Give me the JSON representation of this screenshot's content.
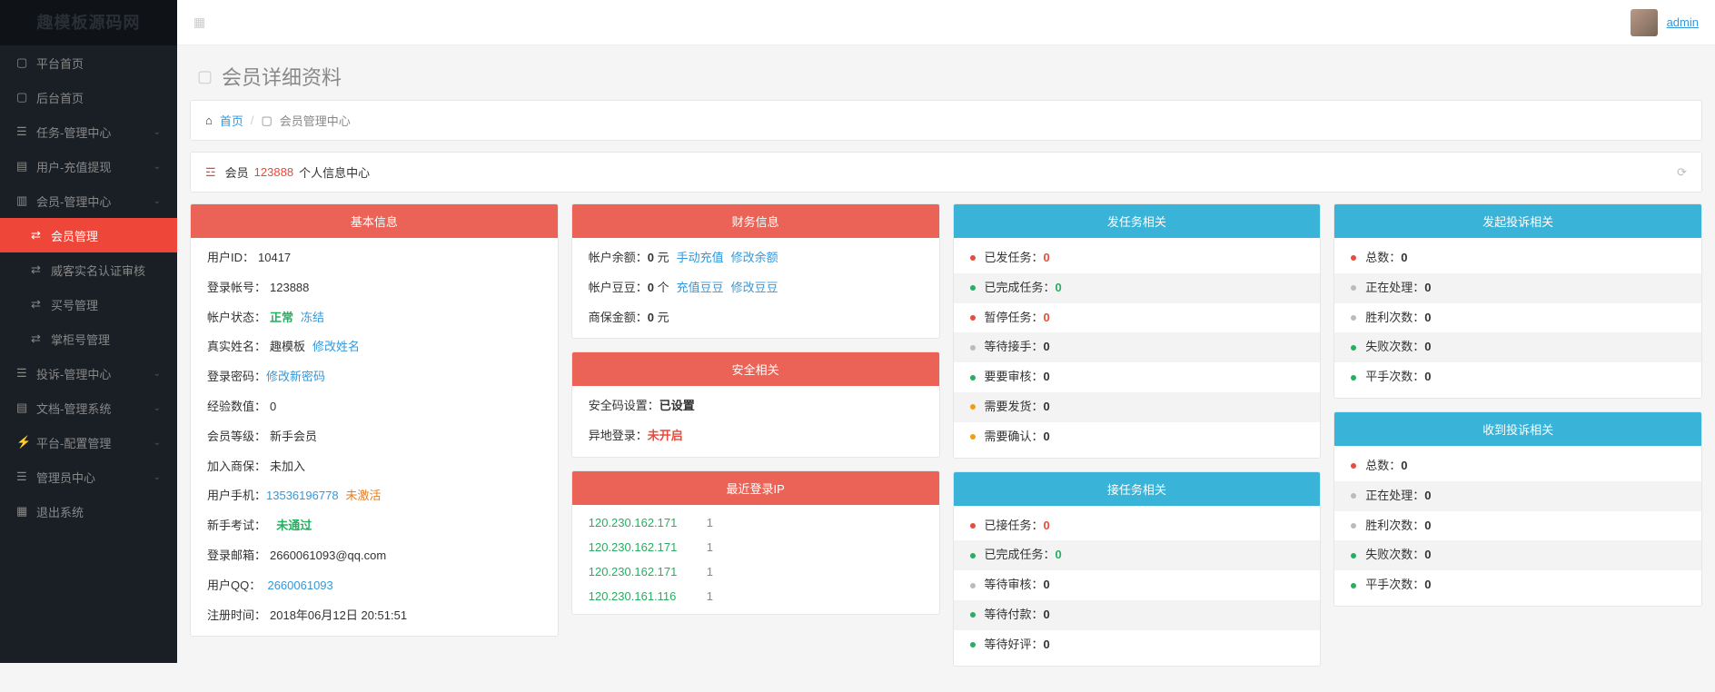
{
  "logo": "趣模板源码网",
  "user": {
    "name": "admin"
  },
  "nav": [
    {
      "icon": "▢",
      "label": "平台首页"
    },
    {
      "icon": "▢",
      "label": "后台首页"
    },
    {
      "icon": "☰",
      "label": "任务-管理中心",
      "chev": true
    },
    {
      "icon": "▤",
      "label": "用户-充值提现",
      "chev": true
    },
    {
      "icon": "▥",
      "label": "会员-管理中心",
      "chev": true
    },
    {
      "icon": "⇄",
      "label": "会员管理",
      "active": true,
      "sub": true
    },
    {
      "icon": "⇄",
      "label": "威客实名认证审核",
      "sub": true
    },
    {
      "icon": "⇄",
      "label": "买号管理",
      "sub": true
    },
    {
      "icon": "⇄",
      "label": "掌柜号管理",
      "sub": true
    },
    {
      "icon": "☰",
      "label": "投诉-管理中心",
      "chev": true
    },
    {
      "icon": "▤",
      "label": "文档-管理系统",
      "chev": true
    },
    {
      "icon": "⚡",
      "label": "平台-配置管理",
      "chev": true
    },
    {
      "icon": "☰",
      "label": "管理员中心",
      "chev": true
    },
    {
      "icon": "▦",
      "label": "退出系统"
    }
  ],
  "pageTitle": "会员详细资料",
  "breadcrumb": {
    "home": "首页",
    "current": "会员管理中心"
  },
  "panel": {
    "prefix": "会员",
    "id": "123888",
    "suffix": "个人信息中心"
  },
  "basic": {
    "title": "基本信息",
    "userId": {
      "l": "用户ID：",
      "v": "10417"
    },
    "account": {
      "l": "登录帐号：",
      "v": "123888"
    },
    "status": {
      "l": "帐户状态：",
      "v": "正常",
      "action": "冻结"
    },
    "realname": {
      "l": "真实姓名：",
      "v": "趣模板",
      "action": "修改姓名"
    },
    "pwd": {
      "l": "登录密码：",
      "action": "修改新密码"
    },
    "exp": {
      "l": "经验数值：",
      "v": "0"
    },
    "level": {
      "l": "会员等级：",
      "v": "新手会员"
    },
    "merch": {
      "l": "加入商保：",
      "v": "未加入"
    },
    "phone": {
      "l": "用户手机：",
      "v": "13536196778",
      "status": "未激活"
    },
    "exam": {
      "l": "新手考试：",
      "v": "未通过"
    },
    "email": {
      "l": "登录邮箱：",
      "v": "2660061093@qq.com"
    },
    "qq": {
      "l": "用户QQ：",
      "v": "2660061093"
    },
    "reg": {
      "l": "注册时间：",
      "v": "2018年06月12日 20:51:51"
    }
  },
  "finance": {
    "title": "财务信息",
    "balance": {
      "l": "帐户余额：",
      "v": "0",
      "u": "元",
      "a1": "手动充值",
      "a2": "修改余额"
    },
    "bean": {
      "l": "帐户豆豆：",
      "v": "0",
      "u": "个",
      "a1": "充值豆豆",
      "a2": "修改豆豆"
    },
    "deposit": {
      "l": "商保金额：",
      "v": "0",
      "u": "元"
    }
  },
  "security": {
    "title": "安全相关",
    "code": {
      "l": "安全码设置：",
      "v": "已设置"
    },
    "remote": {
      "l": "异地登录：",
      "v": "未开启"
    }
  },
  "ips": {
    "title": "最近登录IP",
    "list": [
      {
        "ip": "120.230.162.171",
        "c": "1"
      },
      {
        "ip": "120.230.162.171",
        "c": "1"
      },
      {
        "ip": "120.230.162.171",
        "c": "1"
      },
      {
        "ip": "120.230.161.116",
        "c": "1"
      }
    ]
  },
  "publish": {
    "title": "发任务相关",
    "rows": [
      {
        "d": "red",
        "l": "已发任务：",
        "v": "0",
        "c": "txt-red"
      },
      {
        "d": "green",
        "l": "已完成任务：",
        "v": "0",
        "c": "txt-green"
      },
      {
        "d": "red",
        "l": "暂停任务：",
        "v": "0",
        "c": "txt-red"
      },
      {
        "d": "grey",
        "l": "等待接手：",
        "v": "0"
      },
      {
        "d": "green",
        "l": "要要审核：",
        "v": "0"
      },
      {
        "d": "orange",
        "l": "需要发货：",
        "v": "0"
      },
      {
        "d": "orange",
        "l": "需要确认：",
        "v": "0"
      }
    ]
  },
  "accept": {
    "title": "接任务相关",
    "rows": [
      {
        "d": "red",
        "l": "已接任务：",
        "v": "0",
        "c": "txt-red"
      },
      {
        "d": "green",
        "l": "已完成任务：",
        "v": "0",
        "c": "txt-green"
      },
      {
        "d": "grey",
        "l": "等待审核：",
        "v": "0"
      },
      {
        "d": "green",
        "l": "等待付款：",
        "v": "0"
      },
      {
        "d": "green",
        "l": "等待好评：",
        "v": "0"
      }
    ]
  },
  "sent": {
    "title": "发起投诉相关",
    "rows": [
      {
        "d": "red",
        "l": "总数：",
        "v": "0"
      },
      {
        "d": "grey",
        "l": "正在处理：",
        "v": "0"
      },
      {
        "d": "grey",
        "l": "胜利次数：",
        "v": "0"
      },
      {
        "d": "green",
        "l": "失败次数：",
        "v": "0"
      },
      {
        "d": "green",
        "l": "平手次数：",
        "v": "0"
      }
    ]
  },
  "recv": {
    "title": "收到投诉相关",
    "rows": [
      {
        "d": "red",
        "l": "总数：",
        "v": "0"
      },
      {
        "d": "grey",
        "l": "正在处理：",
        "v": "0"
      },
      {
        "d": "grey",
        "l": "胜利次数：",
        "v": "0"
      },
      {
        "d": "green",
        "l": "失败次数：",
        "v": "0"
      },
      {
        "d": "green",
        "l": "平手次数：",
        "v": "0"
      }
    ]
  }
}
